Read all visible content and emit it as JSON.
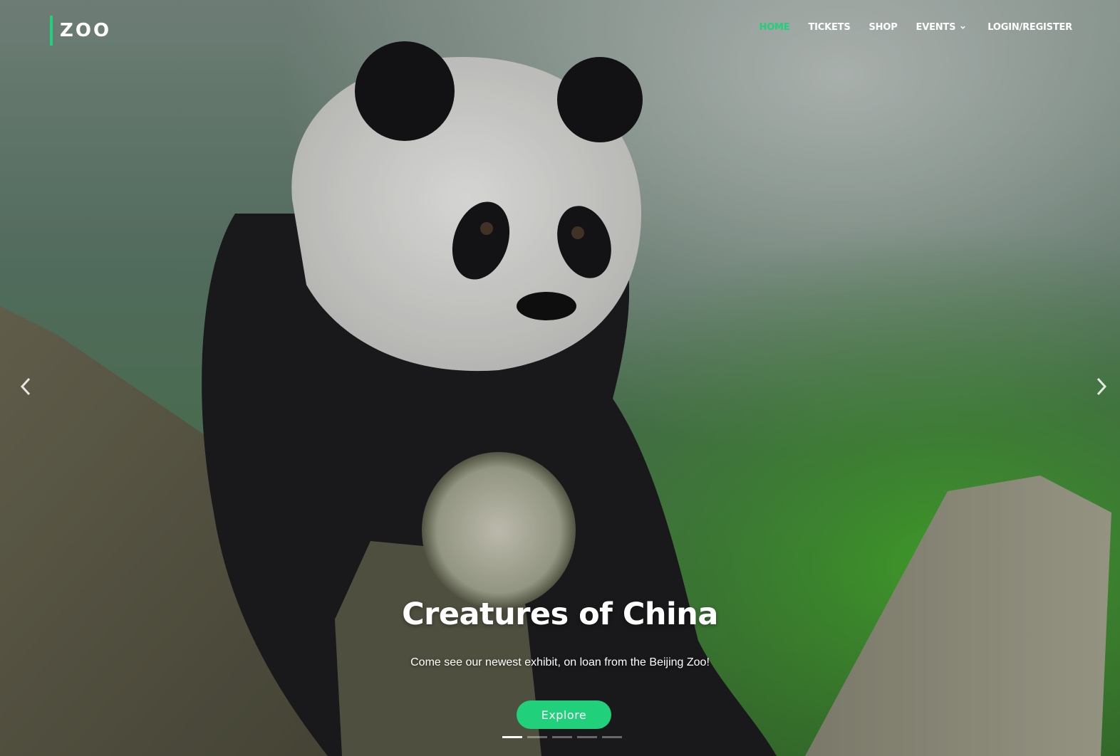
{
  "brand": {
    "logo_text": "ZOO",
    "accent_color": "#21d07a"
  },
  "nav": {
    "items": [
      {
        "label": "HOME",
        "active": true
      },
      {
        "label": "TICKETS",
        "active": false
      },
      {
        "label": "SHOP",
        "active": false
      },
      {
        "label": "EVENTS",
        "active": false,
        "has_dropdown": true
      }
    ],
    "login_label": "LOGIN/REGISTER"
  },
  "hero": {
    "image_icon": "panda-photo",
    "title": "Creatures of China",
    "subtitle": "Come see our newest exhibit, on loan from the Beijing Zoo!",
    "cta_label": "Explore",
    "prev_icon": "chevron-left-icon",
    "next_icon": "chevron-right-icon"
  },
  "carousel": {
    "slide_count": 5,
    "active_index": 0
  }
}
